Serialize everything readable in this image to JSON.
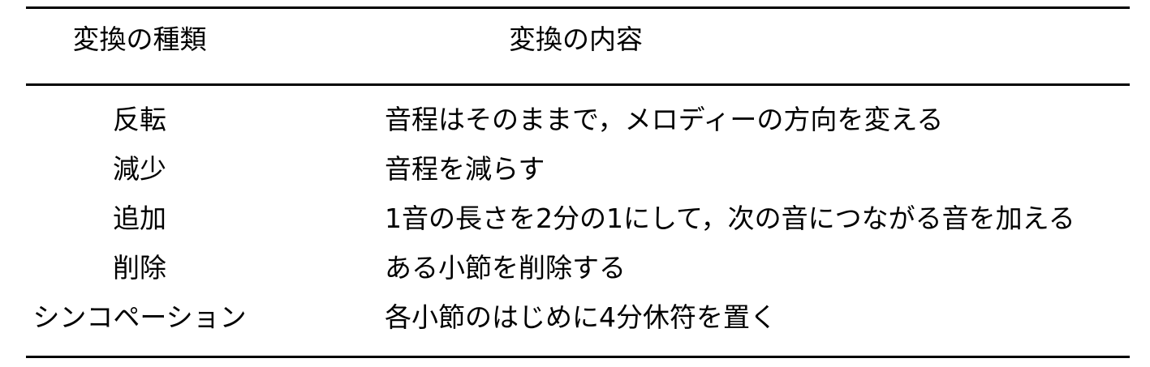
{
  "table": {
    "headers": {
      "type": "変換の種類",
      "content": "変換の内容"
    },
    "rows": [
      {
        "type": "反転",
        "content": "音程はそのままで，メロディーの方向を変える"
      },
      {
        "type": "減少",
        "content": "音程を減らす"
      },
      {
        "type": "追加",
        "content": "1音の長さを2分の1にして，次の音につながる音を加える"
      },
      {
        "type": "削除",
        "content": "ある小節を削除する"
      },
      {
        "type": "シンコペーション",
        "content": "各小節のはじめに4分休符を置く"
      }
    ]
  }
}
